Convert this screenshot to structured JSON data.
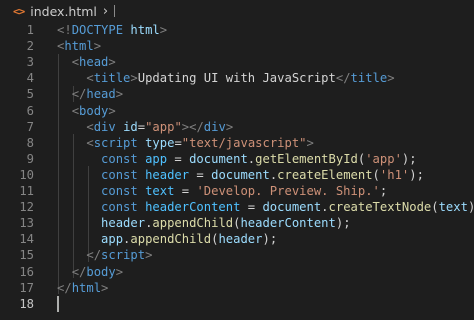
{
  "breadcrumb": {
    "icon": "html-file-icon",
    "icon_glyph": "<>",
    "file_name": "index.html",
    "chevron": "›"
  },
  "editor": {
    "active_line": 18,
    "line_numbers": [
      "1",
      "2",
      "3",
      "4",
      "5",
      "6",
      "7",
      "8",
      "9",
      "10",
      "11",
      "12",
      "13",
      "14",
      "15",
      "16",
      "17",
      "18"
    ],
    "colors": {
      "background": "#1e1e1e",
      "tag": "#569cd6",
      "attribute": "#9cdcfe",
      "string": "#ce9178",
      "function": "#dcdcaa",
      "constant": "#4fc1ff",
      "punctuation": "#808080"
    },
    "lines": [
      [
        [
          "t-punc",
          "<!"
        ],
        [
          "t-tag",
          "DOCTYPE"
        ],
        [
          "t-text",
          " "
        ],
        [
          "t-attr",
          "html"
        ],
        [
          "t-punc",
          ">"
        ]
      ],
      [
        [
          "t-punc",
          "<"
        ],
        [
          "t-tag",
          "html"
        ],
        [
          "t-punc",
          ">"
        ]
      ],
      [
        [
          "t-text",
          "  "
        ],
        [
          "t-punc",
          "<"
        ],
        [
          "t-tag",
          "head"
        ],
        [
          "t-punc",
          ">"
        ]
      ],
      [
        [
          "t-text",
          "    "
        ],
        [
          "t-punc",
          "<"
        ],
        [
          "t-tag",
          "title"
        ],
        [
          "t-punc",
          ">"
        ],
        [
          "t-text",
          "Updating UI with JavaScript"
        ],
        [
          "t-punc",
          "</"
        ],
        [
          "t-tag",
          "title"
        ],
        [
          "t-punc",
          ">"
        ]
      ],
      [
        [
          "t-text",
          "  "
        ],
        [
          "t-punc",
          "</"
        ],
        [
          "t-tag",
          "head"
        ],
        [
          "t-punc",
          ">"
        ]
      ],
      [
        [
          "t-text",
          "  "
        ],
        [
          "t-punc",
          "<"
        ],
        [
          "t-tag",
          "body"
        ],
        [
          "t-punc",
          ">"
        ]
      ],
      [
        [
          "t-text",
          "    "
        ],
        [
          "t-punc",
          "<"
        ],
        [
          "t-tag",
          "div"
        ],
        [
          "t-text",
          " "
        ],
        [
          "t-attr",
          "id"
        ],
        [
          "t-text",
          "="
        ],
        [
          "t-str",
          "\"app\""
        ],
        [
          "t-punc",
          "></"
        ],
        [
          "t-tag",
          "div"
        ],
        [
          "t-punc",
          ">"
        ]
      ],
      [
        [
          "t-text",
          "    "
        ],
        [
          "t-punc",
          "<"
        ],
        [
          "t-tag",
          "script"
        ],
        [
          "t-text",
          " "
        ],
        [
          "t-attr",
          "type"
        ],
        [
          "t-text",
          "="
        ],
        [
          "t-str",
          "\"text/javascript\""
        ],
        [
          "t-punc",
          ">"
        ]
      ],
      [
        [
          "t-text",
          "      "
        ],
        [
          "t-kw",
          "const"
        ],
        [
          "t-text",
          " "
        ],
        [
          "t-var",
          "app"
        ],
        [
          "t-text",
          " = "
        ],
        [
          "t-prop",
          "document"
        ],
        [
          "t-text",
          "."
        ],
        [
          "t-fn",
          "getElementById"
        ],
        [
          "t-text",
          "("
        ],
        [
          "t-str",
          "'app'"
        ],
        [
          "t-text",
          ");"
        ]
      ],
      [
        [
          "t-text",
          "      "
        ],
        [
          "t-kw",
          "const"
        ],
        [
          "t-text",
          " "
        ],
        [
          "t-var",
          "header"
        ],
        [
          "t-text",
          " = "
        ],
        [
          "t-prop",
          "document"
        ],
        [
          "t-text",
          "."
        ],
        [
          "t-fn",
          "createElement"
        ],
        [
          "t-text",
          "("
        ],
        [
          "t-str",
          "'h1'"
        ],
        [
          "t-text",
          ");"
        ]
      ],
      [
        [
          "t-text",
          "      "
        ],
        [
          "t-kw",
          "const"
        ],
        [
          "t-text",
          " "
        ],
        [
          "t-var",
          "text"
        ],
        [
          "t-text",
          " = "
        ],
        [
          "t-str",
          "'Develop. Preview. Ship.'"
        ],
        [
          "t-text",
          ";"
        ]
      ],
      [
        [
          "t-text",
          "      "
        ],
        [
          "t-kw",
          "const"
        ],
        [
          "t-text",
          " "
        ],
        [
          "t-var",
          "headerContent"
        ],
        [
          "t-text",
          " = "
        ],
        [
          "t-prop",
          "document"
        ],
        [
          "t-text",
          "."
        ],
        [
          "t-fn",
          "createTextNode"
        ],
        [
          "t-text",
          "("
        ],
        [
          "t-prop",
          "text"
        ],
        [
          "t-text",
          ");"
        ]
      ],
      [
        [
          "t-text",
          "      "
        ],
        [
          "t-prop",
          "header"
        ],
        [
          "t-text",
          "."
        ],
        [
          "t-fn",
          "appendChild"
        ],
        [
          "t-text",
          "("
        ],
        [
          "t-prop",
          "headerContent"
        ],
        [
          "t-text",
          ");"
        ]
      ],
      [
        [
          "t-text",
          "      "
        ],
        [
          "t-prop",
          "app"
        ],
        [
          "t-text",
          "."
        ],
        [
          "t-fn",
          "appendChild"
        ],
        [
          "t-text",
          "("
        ],
        [
          "t-prop",
          "header"
        ],
        [
          "t-text",
          ");"
        ]
      ],
      [
        [
          "t-text",
          "    "
        ],
        [
          "t-punc",
          "</"
        ],
        [
          "t-tag",
          "script"
        ],
        [
          "t-punc",
          ">"
        ]
      ],
      [
        [
          "t-text",
          "  "
        ],
        [
          "t-punc",
          "</"
        ],
        [
          "t-tag",
          "body"
        ],
        [
          "t-punc",
          ">"
        ]
      ],
      [
        [
          "t-punc",
          "</"
        ],
        [
          "t-tag",
          "html"
        ],
        [
          "t-punc",
          ">"
        ]
      ],
      []
    ]
  }
}
